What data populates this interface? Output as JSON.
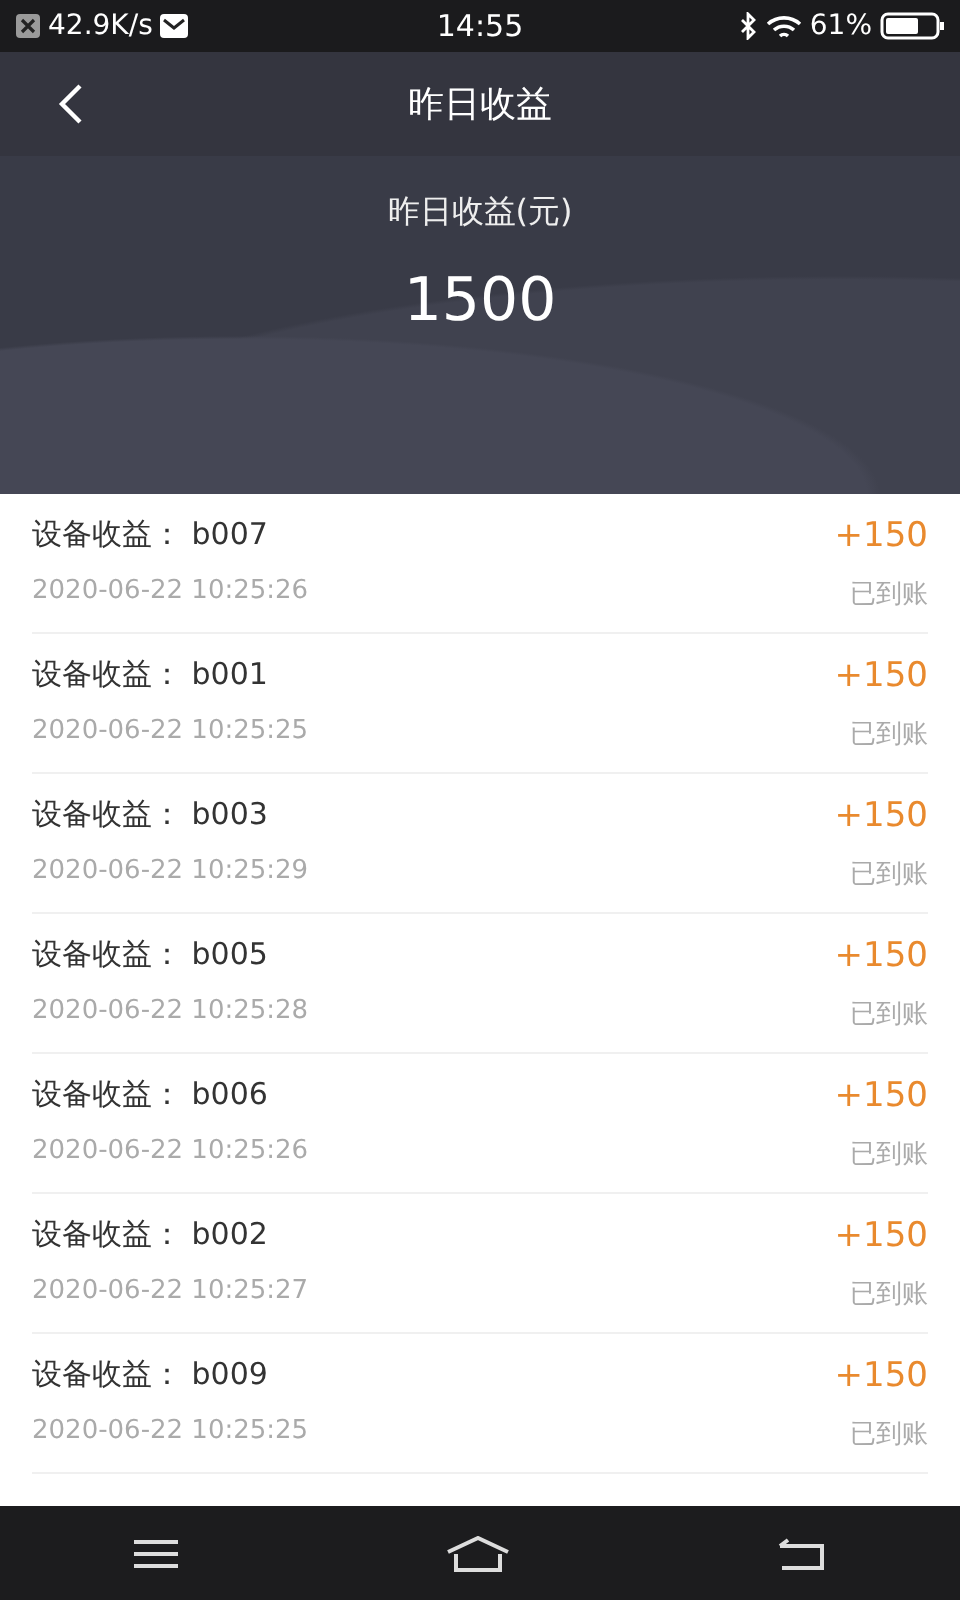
{
  "status_bar": {
    "speed": "42.9K/s",
    "time": "14:55",
    "battery": "61%"
  },
  "header": {
    "title": "昨日收益"
  },
  "summary": {
    "label": "昨日收益(元)",
    "amount": "1500"
  },
  "records": [
    {
      "title": "设备收益： b007",
      "time": "2020-06-22 10:25:26",
      "amount": "+150",
      "status": "已到账"
    },
    {
      "title": "设备收益： b001",
      "time": "2020-06-22 10:25:25",
      "amount": "+150",
      "status": "已到账"
    },
    {
      "title": "设备收益： b003",
      "time": "2020-06-22 10:25:29",
      "amount": "+150",
      "status": "已到账"
    },
    {
      "title": "设备收益： b005",
      "time": "2020-06-22 10:25:28",
      "amount": "+150",
      "status": "已到账"
    },
    {
      "title": "设备收益： b006",
      "time": "2020-06-22 10:25:26",
      "amount": "+150",
      "status": "已到账"
    },
    {
      "title": "设备收益： b002",
      "time": "2020-06-22 10:25:27",
      "amount": "+150",
      "status": "已到账"
    },
    {
      "title": "设备收益： b009",
      "time": "2020-06-22 10:25:25",
      "amount": "+150",
      "status": "已到账"
    }
  ]
}
